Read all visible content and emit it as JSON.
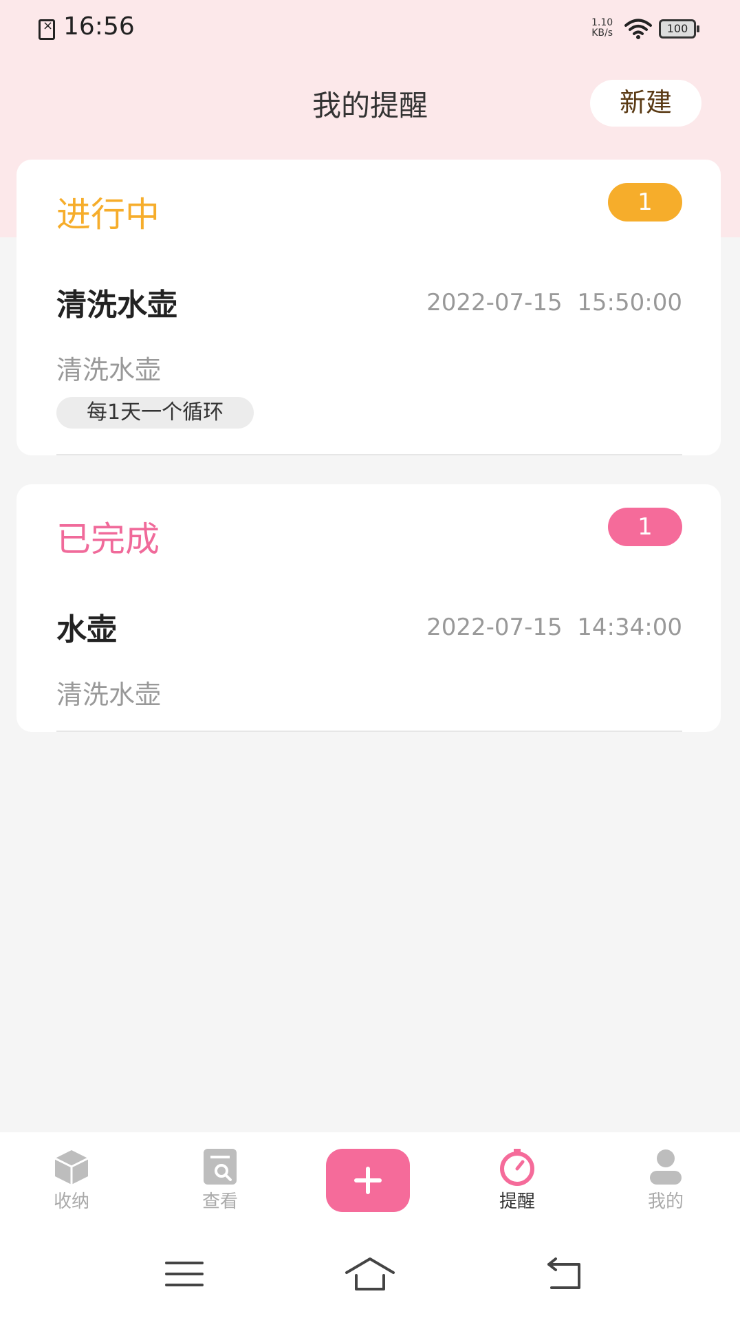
{
  "status_bar": {
    "time": "16:56",
    "net_speed_value": "1.10",
    "net_speed_unit": "KB/s",
    "battery": "100",
    "icons": [
      "sim-error-icon",
      "wifi-icon",
      "battery-icon"
    ]
  },
  "header": {
    "title": "我的提醒",
    "new_label": "新建"
  },
  "ongoing": {
    "title": "进行中",
    "count": "1",
    "color": "#f6ad2b",
    "items": [
      {
        "title": "清洗水壶",
        "time": "2022-07-15  15:50:00",
        "desc": "清洗水壶",
        "cycle": "每1天一个循环"
      }
    ]
  },
  "done": {
    "title": "已完成",
    "count": "1",
    "color": "#f56b9a",
    "items": [
      {
        "title": "水壶",
        "time": "2022-07-15  14:34:00",
        "desc": "清洗水壶"
      }
    ]
  },
  "bottom_nav": {
    "items": [
      {
        "label": "收纳",
        "icon": "box-icon"
      },
      {
        "label": "查看",
        "icon": "search-doc-icon"
      },
      {
        "label": "",
        "icon": "plus-icon"
      },
      {
        "label": "提醒",
        "icon": "timer-icon",
        "active": true
      },
      {
        "label": "我的",
        "icon": "person-icon"
      }
    ],
    "accent": "#f56b9a"
  },
  "system_nav": {
    "icons": [
      "menu-icon",
      "home-icon",
      "back-icon"
    ]
  }
}
